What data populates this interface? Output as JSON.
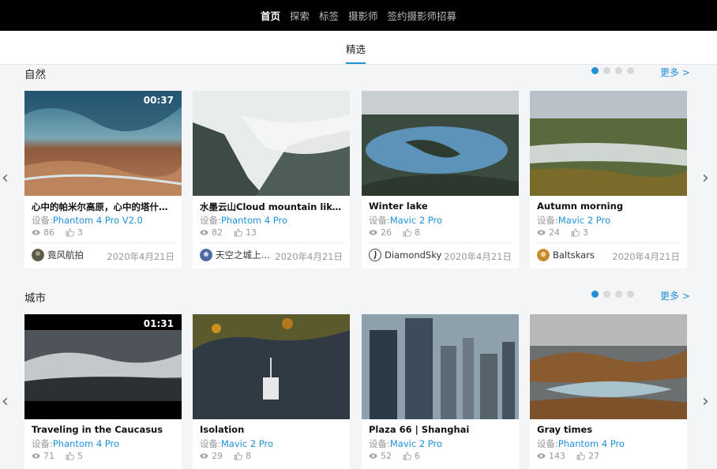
{
  "nav": {
    "items": [
      "首页",
      "探索",
      "标签",
      "摄影师",
      "签约摄影师招募"
    ]
  },
  "subnav": {
    "tab": "精选"
  },
  "device_label": "设备:",
  "sections": [
    {
      "title": "自然",
      "more": "更多 >",
      "cards": [
        {
          "title": "心中的帕米尔高原，心中的塔什库尔干",
          "device": "Phantom 4 Pro V2.0",
          "views": "86",
          "likes": "3",
          "author": "竟风航拍",
          "date": "2020年4月21日",
          "duration": "00:37"
        },
        {
          "title": "水墨云山Cloud mountain like ink",
          "device": "Phantom 4 Pro",
          "views": "82",
          "likes": "13",
          "author": "天空之城上的猫",
          "date": "2020年4月21日",
          "duration": ""
        },
        {
          "title": "Winter lake",
          "device": "Mavic 2 Pro",
          "views": "26",
          "likes": "8",
          "author": "DiamondSky",
          "date": "2020年4月21日",
          "duration": ""
        },
        {
          "title": "Autumn morning",
          "device": "Mavic 2 Pro",
          "views": "24",
          "likes": "3",
          "author": "Baltskars",
          "date": "2020年4月21日",
          "duration": ""
        }
      ]
    },
    {
      "title": "城市",
      "more": "更多 >",
      "cards": [
        {
          "title": "Traveling in the Caucasus",
          "device": "Phantom 4 Pro",
          "views": "71",
          "likes": "5",
          "duration": "01:31"
        },
        {
          "title": "Isolation",
          "device": "Mavic 2 Pro",
          "views": "29",
          "likes": "8",
          "duration": ""
        },
        {
          "title": "Plaza 66 | Shanghai",
          "device": "Mavic 2 Pro",
          "views": "52",
          "likes": "6",
          "duration": ""
        },
        {
          "title": "Gray times",
          "device": "Phantom 4 Pro",
          "views": "143",
          "likes": "27",
          "duration": ""
        }
      ]
    }
  ]
}
